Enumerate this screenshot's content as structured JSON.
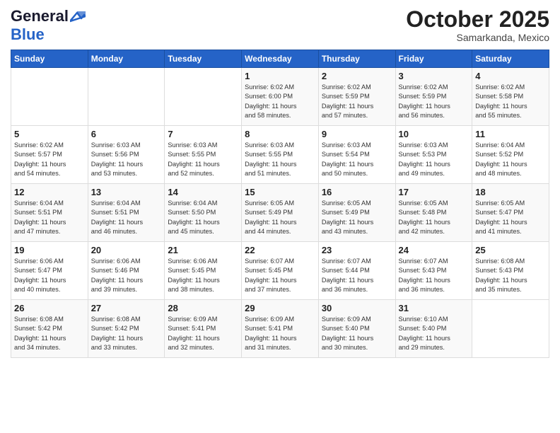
{
  "header": {
    "logo_line1": "General",
    "logo_line2": "Blue",
    "month": "October 2025",
    "location": "Samarkanda, Mexico"
  },
  "days_of_week": [
    "Sunday",
    "Monday",
    "Tuesday",
    "Wednesday",
    "Thursday",
    "Friday",
    "Saturday"
  ],
  "weeks": [
    [
      {
        "day": "",
        "info": ""
      },
      {
        "day": "",
        "info": ""
      },
      {
        "day": "",
        "info": ""
      },
      {
        "day": "1",
        "info": "Sunrise: 6:02 AM\nSunset: 6:00 PM\nDaylight: 11 hours\nand 58 minutes."
      },
      {
        "day": "2",
        "info": "Sunrise: 6:02 AM\nSunset: 5:59 PM\nDaylight: 11 hours\nand 57 minutes."
      },
      {
        "day": "3",
        "info": "Sunrise: 6:02 AM\nSunset: 5:59 PM\nDaylight: 11 hours\nand 56 minutes."
      },
      {
        "day": "4",
        "info": "Sunrise: 6:02 AM\nSunset: 5:58 PM\nDaylight: 11 hours\nand 55 minutes."
      }
    ],
    [
      {
        "day": "5",
        "info": "Sunrise: 6:02 AM\nSunset: 5:57 PM\nDaylight: 11 hours\nand 54 minutes."
      },
      {
        "day": "6",
        "info": "Sunrise: 6:03 AM\nSunset: 5:56 PM\nDaylight: 11 hours\nand 53 minutes."
      },
      {
        "day": "7",
        "info": "Sunrise: 6:03 AM\nSunset: 5:55 PM\nDaylight: 11 hours\nand 52 minutes."
      },
      {
        "day": "8",
        "info": "Sunrise: 6:03 AM\nSunset: 5:55 PM\nDaylight: 11 hours\nand 51 minutes."
      },
      {
        "day": "9",
        "info": "Sunrise: 6:03 AM\nSunset: 5:54 PM\nDaylight: 11 hours\nand 50 minutes."
      },
      {
        "day": "10",
        "info": "Sunrise: 6:03 AM\nSunset: 5:53 PM\nDaylight: 11 hours\nand 49 minutes."
      },
      {
        "day": "11",
        "info": "Sunrise: 6:04 AM\nSunset: 5:52 PM\nDaylight: 11 hours\nand 48 minutes."
      }
    ],
    [
      {
        "day": "12",
        "info": "Sunrise: 6:04 AM\nSunset: 5:51 PM\nDaylight: 11 hours\nand 47 minutes."
      },
      {
        "day": "13",
        "info": "Sunrise: 6:04 AM\nSunset: 5:51 PM\nDaylight: 11 hours\nand 46 minutes."
      },
      {
        "day": "14",
        "info": "Sunrise: 6:04 AM\nSunset: 5:50 PM\nDaylight: 11 hours\nand 45 minutes."
      },
      {
        "day": "15",
        "info": "Sunrise: 6:05 AM\nSunset: 5:49 PM\nDaylight: 11 hours\nand 44 minutes."
      },
      {
        "day": "16",
        "info": "Sunrise: 6:05 AM\nSunset: 5:49 PM\nDaylight: 11 hours\nand 43 minutes."
      },
      {
        "day": "17",
        "info": "Sunrise: 6:05 AM\nSunset: 5:48 PM\nDaylight: 11 hours\nand 42 minutes."
      },
      {
        "day": "18",
        "info": "Sunrise: 6:05 AM\nSunset: 5:47 PM\nDaylight: 11 hours\nand 41 minutes."
      }
    ],
    [
      {
        "day": "19",
        "info": "Sunrise: 6:06 AM\nSunset: 5:47 PM\nDaylight: 11 hours\nand 40 minutes."
      },
      {
        "day": "20",
        "info": "Sunrise: 6:06 AM\nSunset: 5:46 PM\nDaylight: 11 hours\nand 39 minutes."
      },
      {
        "day": "21",
        "info": "Sunrise: 6:06 AM\nSunset: 5:45 PM\nDaylight: 11 hours\nand 38 minutes."
      },
      {
        "day": "22",
        "info": "Sunrise: 6:07 AM\nSunset: 5:45 PM\nDaylight: 11 hours\nand 37 minutes."
      },
      {
        "day": "23",
        "info": "Sunrise: 6:07 AM\nSunset: 5:44 PM\nDaylight: 11 hours\nand 36 minutes."
      },
      {
        "day": "24",
        "info": "Sunrise: 6:07 AM\nSunset: 5:43 PM\nDaylight: 11 hours\nand 36 minutes."
      },
      {
        "day": "25",
        "info": "Sunrise: 6:08 AM\nSunset: 5:43 PM\nDaylight: 11 hours\nand 35 minutes."
      }
    ],
    [
      {
        "day": "26",
        "info": "Sunrise: 6:08 AM\nSunset: 5:42 PM\nDaylight: 11 hours\nand 34 minutes."
      },
      {
        "day": "27",
        "info": "Sunrise: 6:08 AM\nSunset: 5:42 PM\nDaylight: 11 hours\nand 33 minutes."
      },
      {
        "day": "28",
        "info": "Sunrise: 6:09 AM\nSunset: 5:41 PM\nDaylight: 11 hours\nand 32 minutes."
      },
      {
        "day": "29",
        "info": "Sunrise: 6:09 AM\nSunset: 5:41 PM\nDaylight: 11 hours\nand 31 minutes."
      },
      {
        "day": "30",
        "info": "Sunrise: 6:09 AM\nSunset: 5:40 PM\nDaylight: 11 hours\nand 30 minutes."
      },
      {
        "day": "31",
        "info": "Sunrise: 6:10 AM\nSunset: 5:40 PM\nDaylight: 11 hours\nand 29 minutes."
      },
      {
        "day": "",
        "info": ""
      }
    ]
  ]
}
